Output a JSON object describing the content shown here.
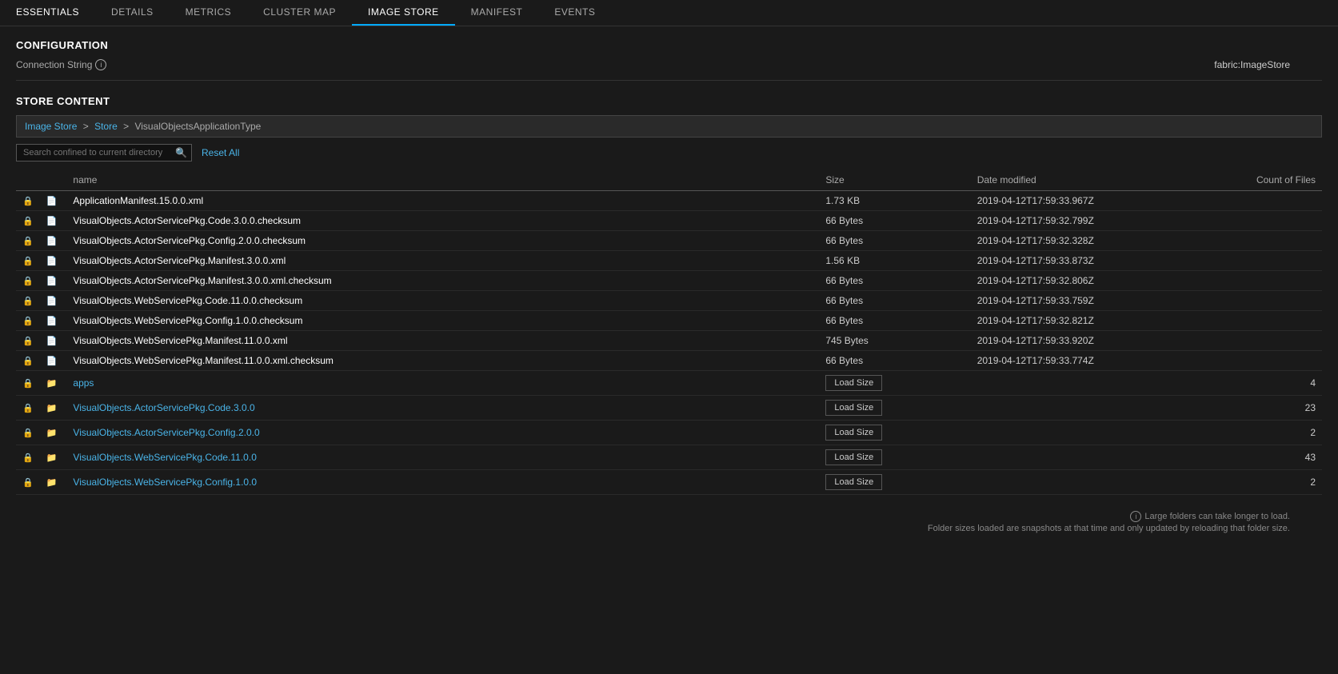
{
  "nav": {
    "items": [
      {
        "label": "ESSENTIALS",
        "active": false
      },
      {
        "label": "DETAILS",
        "active": false
      },
      {
        "label": "METRICS",
        "active": false
      },
      {
        "label": "CLUSTER MAP",
        "active": false
      },
      {
        "label": "IMAGE STORE",
        "active": true
      },
      {
        "label": "MANIFEST",
        "active": false
      },
      {
        "label": "EVENTS",
        "active": false
      }
    ]
  },
  "config": {
    "title": "CONFIGURATION",
    "connection_string_label": "Connection String",
    "connection_string_value": "fabric:ImageStore"
  },
  "store": {
    "title": "STORE CONTENT",
    "breadcrumb": [
      {
        "label": "Image Store",
        "link": true
      },
      {
        "label": "Store",
        "link": true
      },
      {
        "label": "VisualObjectsApplicationType",
        "link": false
      }
    ],
    "search_placeholder": "Search confined to current directory",
    "reset_label": "Reset All",
    "columns": {
      "name": "name",
      "size": "Size",
      "date": "Date modified",
      "count": "Count of Files"
    },
    "files": [
      {
        "name": "ApplicationManifest.15.0.0.xml",
        "size": "1.73 KB",
        "date": "2019-04-12T17:59:33.967Z",
        "count": "",
        "type": "file"
      },
      {
        "name": "VisualObjects.ActorServicePkg.Code.3.0.0.checksum",
        "size": "66 Bytes",
        "date": "2019-04-12T17:59:32.799Z",
        "count": "",
        "type": "file"
      },
      {
        "name": "VisualObjects.ActorServicePkg.Config.2.0.0.checksum",
        "size": "66 Bytes",
        "date": "2019-04-12T17:59:32.328Z",
        "count": "",
        "type": "file"
      },
      {
        "name": "VisualObjects.ActorServicePkg.Manifest.3.0.0.xml",
        "size": "1.56 KB",
        "date": "2019-04-12T17:59:33.873Z",
        "count": "",
        "type": "file"
      },
      {
        "name": "VisualObjects.ActorServicePkg.Manifest.3.0.0.xml.checksum",
        "size": "66 Bytes",
        "date": "2019-04-12T17:59:32.806Z",
        "count": "",
        "type": "file"
      },
      {
        "name": "VisualObjects.WebServicePkg.Code.11.0.0.checksum",
        "size": "66 Bytes",
        "date": "2019-04-12T17:59:33.759Z",
        "count": "",
        "type": "file"
      },
      {
        "name": "VisualObjects.WebServicePkg.Config.1.0.0.checksum",
        "size": "66 Bytes",
        "date": "2019-04-12T17:59:32.821Z",
        "count": "",
        "type": "file"
      },
      {
        "name": "VisualObjects.WebServicePkg.Manifest.11.0.0.xml",
        "size": "745 Bytes",
        "date": "2019-04-12T17:59:33.920Z",
        "count": "",
        "type": "file"
      },
      {
        "name": "VisualObjects.WebServicePkg.Manifest.11.0.0.xml.checksum",
        "size": "66 Bytes",
        "date": "2019-04-12T17:59:33.774Z",
        "count": "",
        "type": "file"
      }
    ],
    "folders": [
      {
        "name": "apps",
        "count": "4",
        "type": "folder"
      },
      {
        "name": "VisualObjects.ActorServicePkg.Code.3.0.0",
        "count": "23",
        "type": "folder"
      },
      {
        "name": "VisualObjects.ActorServicePkg.Config.2.0.0",
        "count": "2",
        "type": "folder"
      },
      {
        "name": "VisualObjects.WebServicePkg.Code.11.0.0",
        "count": "43",
        "type": "folder"
      },
      {
        "name": "VisualObjects.WebServicePkg.Config.1.0.0",
        "count": "2",
        "type": "folder"
      }
    ],
    "load_size_label": "Load Size",
    "footer_note1": "Large folders can take longer to load.",
    "footer_note2": "Folder sizes loaded are snapshots at that time and only updated by reloading that folder size."
  }
}
